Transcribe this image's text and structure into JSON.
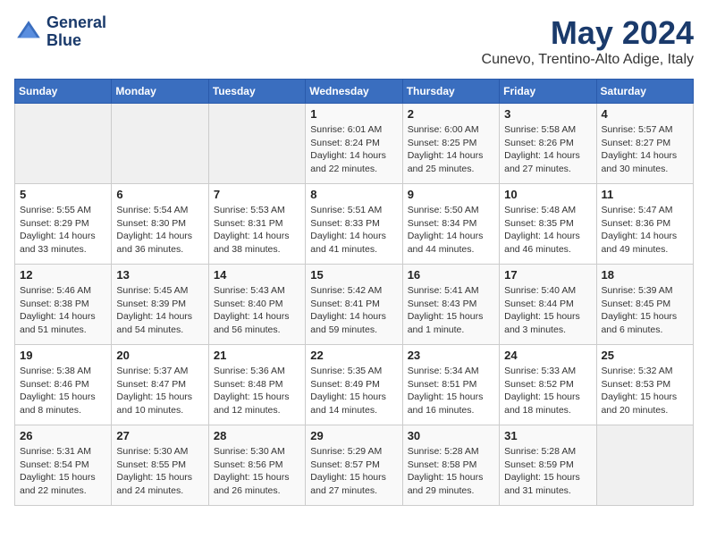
{
  "header": {
    "logo_line1": "General",
    "logo_line2": "Blue",
    "month_title": "May 2024",
    "subtitle": "Cunevo, Trentino-Alto Adige, Italy"
  },
  "weekdays": [
    "Sunday",
    "Monday",
    "Tuesday",
    "Wednesday",
    "Thursday",
    "Friday",
    "Saturday"
  ],
  "weeks": [
    [
      {
        "day": "",
        "info": ""
      },
      {
        "day": "",
        "info": ""
      },
      {
        "day": "",
        "info": ""
      },
      {
        "day": "1",
        "info": "Sunrise: 6:01 AM\nSunset: 8:24 PM\nDaylight: 14 hours\nand 22 minutes."
      },
      {
        "day": "2",
        "info": "Sunrise: 6:00 AM\nSunset: 8:25 PM\nDaylight: 14 hours\nand 25 minutes."
      },
      {
        "day": "3",
        "info": "Sunrise: 5:58 AM\nSunset: 8:26 PM\nDaylight: 14 hours\nand 27 minutes."
      },
      {
        "day": "4",
        "info": "Sunrise: 5:57 AM\nSunset: 8:27 PM\nDaylight: 14 hours\nand 30 minutes."
      }
    ],
    [
      {
        "day": "5",
        "info": "Sunrise: 5:55 AM\nSunset: 8:29 PM\nDaylight: 14 hours\nand 33 minutes."
      },
      {
        "day": "6",
        "info": "Sunrise: 5:54 AM\nSunset: 8:30 PM\nDaylight: 14 hours\nand 36 minutes."
      },
      {
        "day": "7",
        "info": "Sunrise: 5:53 AM\nSunset: 8:31 PM\nDaylight: 14 hours\nand 38 minutes."
      },
      {
        "day": "8",
        "info": "Sunrise: 5:51 AM\nSunset: 8:33 PM\nDaylight: 14 hours\nand 41 minutes."
      },
      {
        "day": "9",
        "info": "Sunrise: 5:50 AM\nSunset: 8:34 PM\nDaylight: 14 hours\nand 44 minutes."
      },
      {
        "day": "10",
        "info": "Sunrise: 5:48 AM\nSunset: 8:35 PM\nDaylight: 14 hours\nand 46 minutes."
      },
      {
        "day": "11",
        "info": "Sunrise: 5:47 AM\nSunset: 8:36 PM\nDaylight: 14 hours\nand 49 minutes."
      }
    ],
    [
      {
        "day": "12",
        "info": "Sunrise: 5:46 AM\nSunset: 8:38 PM\nDaylight: 14 hours\nand 51 minutes."
      },
      {
        "day": "13",
        "info": "Sunrise: 5:45 AM\nSunset: 8:39 PM\nDaylight: 14 hours\nand 54 minutes."
      },
      {
        "day": "14",
        "info": "Sunrise: 5:43 AM\nSunset: 8:40 PM\nDaylight: 14 hours\nand 56 minutes."
      },
      {
        "day": "15",
        "info": "Sunrise: 5:42 AM\nSunset: 8:41 PM\nDaylight: 14 hours\nand 59 minutes."
      },
      {
        "day": "16",
        "info": "Sunrise: 5:41 AM\nSunset: 8:43 PM\nDaylight: 15 hours\nand 1 minute."
      },
      {
        "day": "17",
        "info": "Sunrise: 5:40 AM\nSunset: 8:44 PM\nDaylight: 15 hours\nand 3 minutes."
      },
      {
        "day": "18",
        "info": "Sunrise: 5:39 AM\nSunset: 8:45 PM\nDaylight: 15 hours\nand 6 minutes."
      }
    ],
    [
      {
        "day": "19",
        "info": "Sunrise: 5:38 AM\nSunset: 8:46 PM\nDaylight: 15 hours\nand 8 minutes."
      },
      {
        "day": "20",
        "info": "Sunrise: 5:37 AM\nSunset: 8:47 PM\nDaylight: 15 hours\nand 10 minutes."
      },
      {
        "day": "21",
        "info": "Sunrise: 5:36 AM\nSunset: 8:48 PM\nDaylight: 15 hours\nand 12 minutes."
      },
      {
        "day": "22",
        "info": "Sunrise: 5:35 AM\nSunset: 8:49 PM\nDaylight: 15 hours\nand 14 minutes."
      },
      {
        "day": "23",
        "info": "Sunrise: 5:34 AM\nSunset: 8:51 PM\nDaylight: 15 hours\nand 16 minutes."
      },
      {
        "day": "24",
        "info": "Sunrise: 5:33 AM\nSunset: 8:52 PM\nDaylight: 15 hours\nand 18 minutes."
      },
      {
        "day": "25",
        "info": "Sunrise: 5:32 AM\nSunset: 8:53 PM\nDaylight: 15 hours\nand 20 minutes."
      }
    ],
    [
      {
        "day": "26",
        "info": "Sunrise: 5:31 AM\nSunset: 8:54 PM\nDaylight: 15 hours\nand 22 minutes."
      },
      {
        "day": "27",
        "info": "Sunrise: 5:30 AM\nSunset: 8:55 PM\nDaylight: 15 hours\nand 24 minutes."
      },
      {
        "day": "28",
        "info": "Sunrise: 5:30 AM\nSunset: 8:56 PM\nDaylight: 15 hours\nand 26 minutes."
      },
      {
        "day": "29",
        "info": "Sunrise: 5:29 AM\nSunset: 8:57 PM\nDaylight: 15 hours\nand 27 minutes."
      },
      {
        "day": "30",
        "info": "Sunrise: 5:28 AM\nSunset: 8:58 PM\nDaylight: 15 hours\nand 29 minutes."
      },
      {
        "day": "31",
        "info": "Sunrise: 5:28 AM\nSunset: 8:59 PM\nDaylight: 15 hours\nand 31 minutes."
      },
      {
        "day": "",
        "info": ""
      }
    ]
  ]
}
